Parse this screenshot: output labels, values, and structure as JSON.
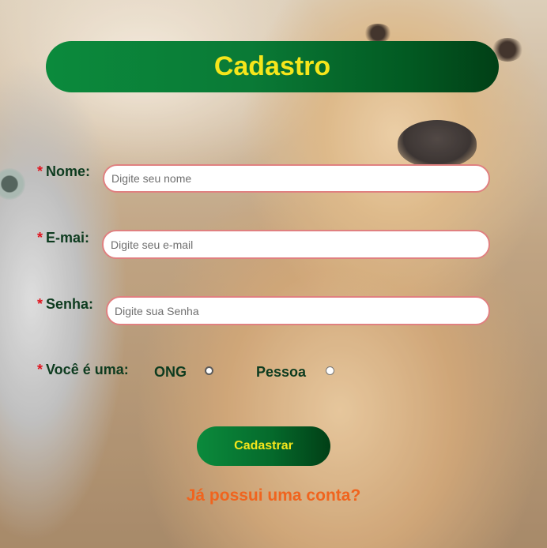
{
  "form": {
    "title": "Cadastro",
    "required_mark": "*",
    "name": {
      "label": "Nome:",
      "placeholder": "Digite seu nome"
    },
    "email": {
      "label": "E-mai:",
      "placeholder": "Digite seu e-mail"
    },
    "password": {
      "label": "Senha:",
      "placeholder": "Digite sua Senha"
    },
    "type": {
      "label": "Você é uma:",
      "options": [
        "ONG",
        "Pessoa"
      ]
    },
    "submit_label": "Cadastrar",
    "login_link": "Já possui uma conta?"
  },
  "colors": {
    "header_green": "#0a7a36",
    "title_yellow": "#f5e61b",
    "label_green": "#0d3b1f",
    "required_red": "#e0141e",
    "input_border": "#e08080",
    "link_orange": "#f0641e"
  },
  "background": {
    "image": "cat-and-dog-photo"
  }
}
